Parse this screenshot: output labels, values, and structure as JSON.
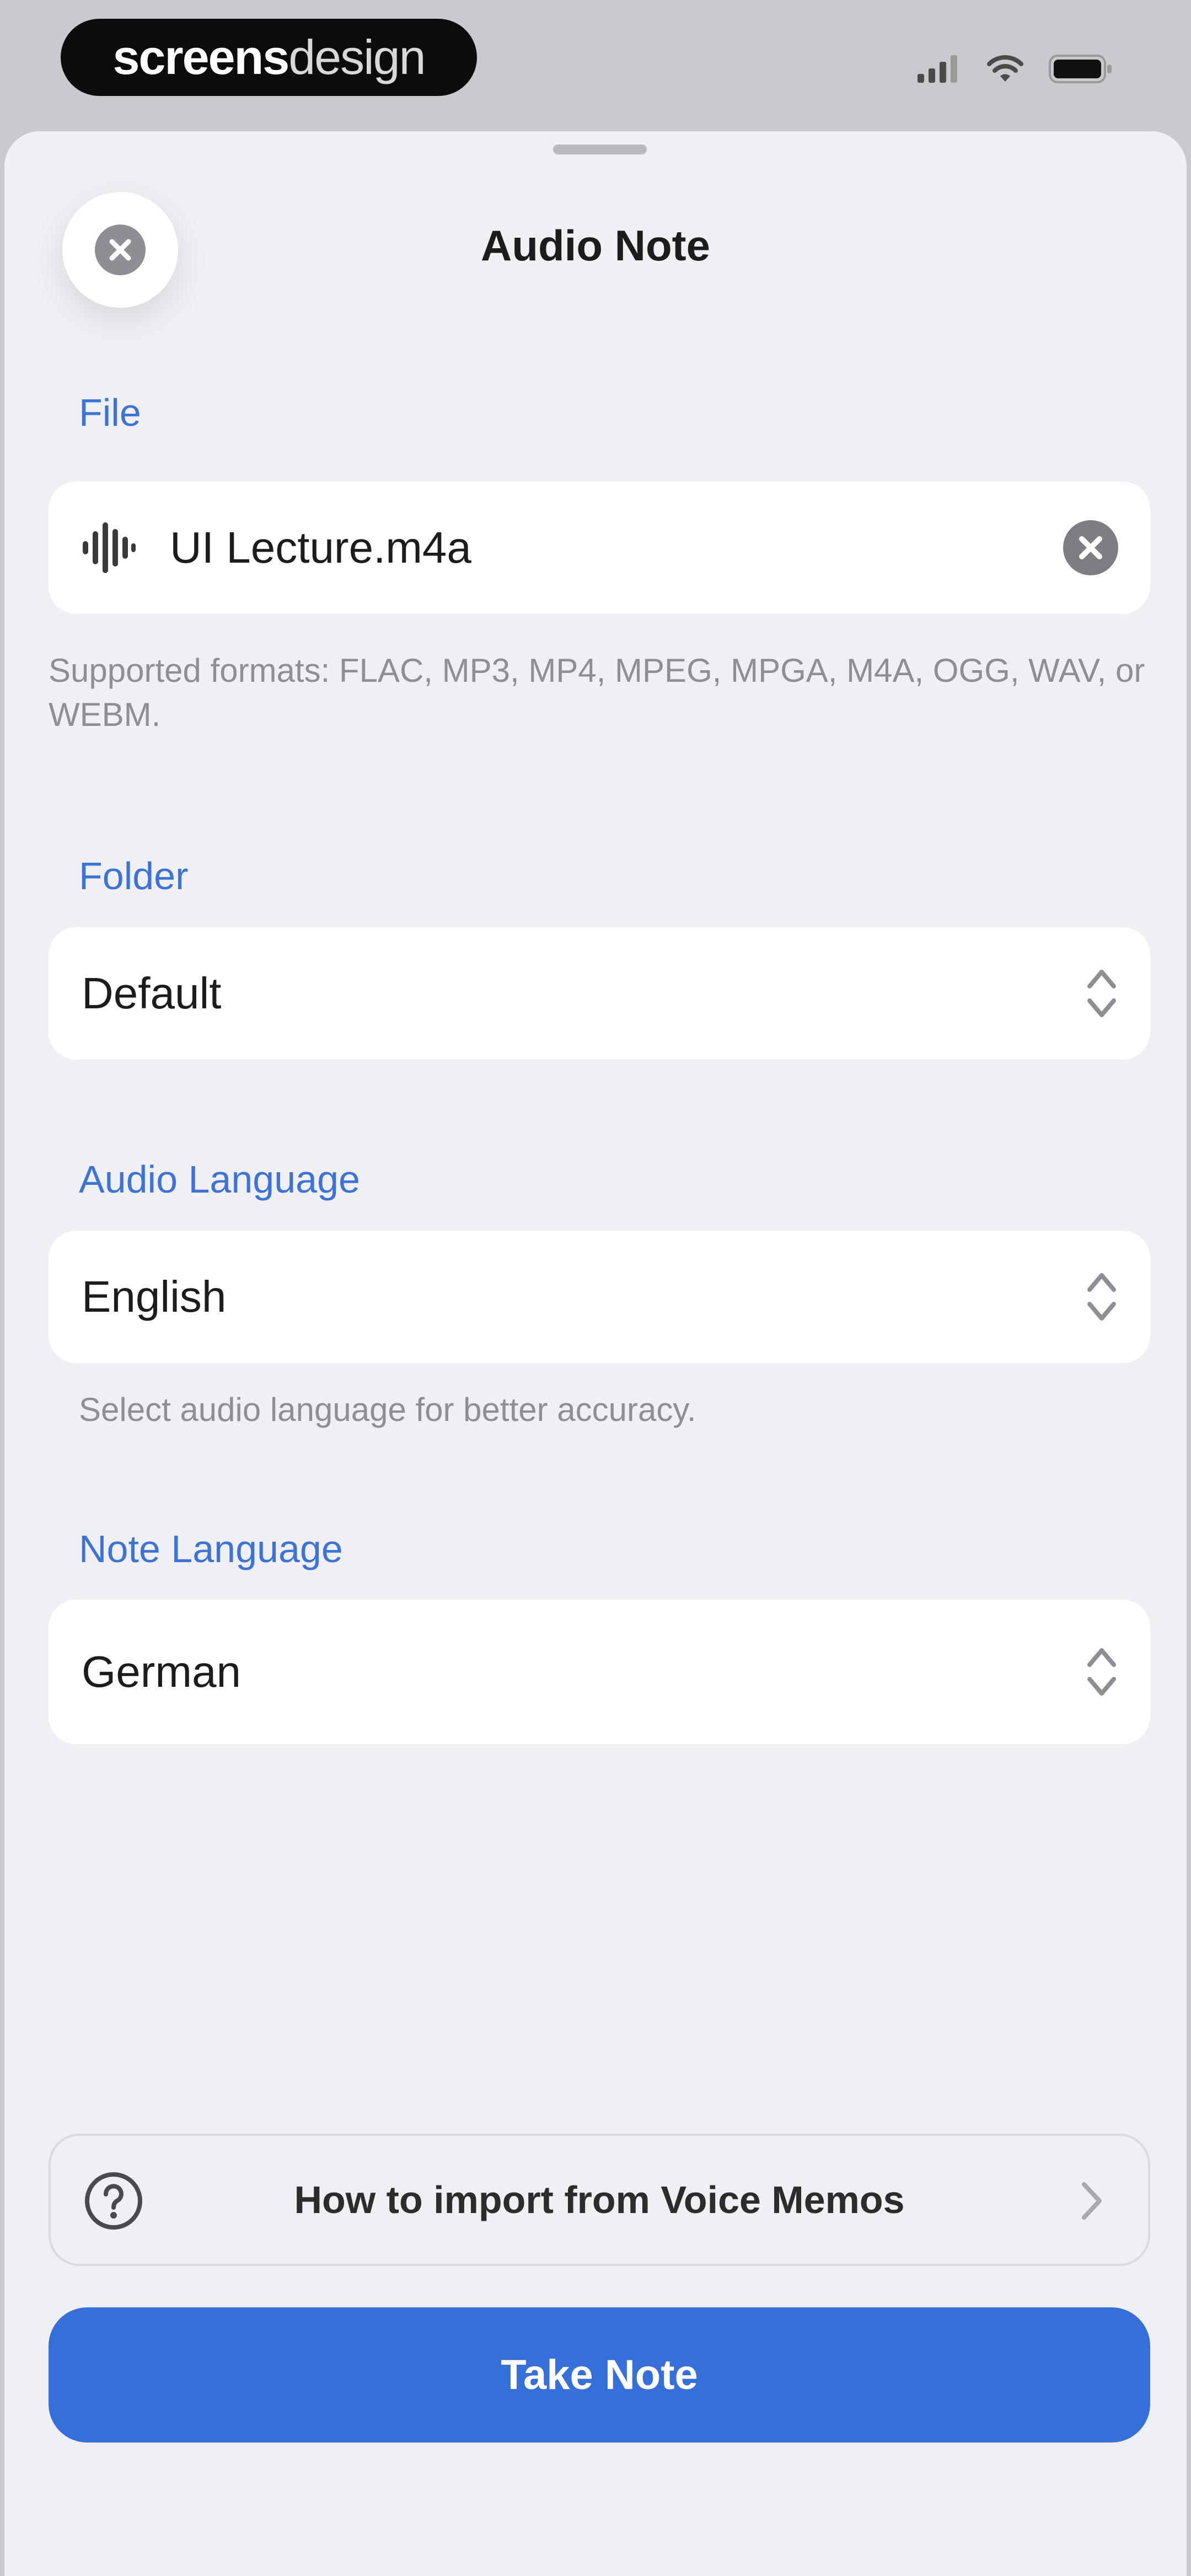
{
  "status_bar": {
    "brand_strong": "screens",
    "brand_light": "design"
  },
  "sheet": {
    "title": "Audio Note"
  },
  "file": {
    "label": "File",
    "filename": "UI Lecture.m4a",
    "helper": "Supported formats: FLAC, MP3, MP4, MPEG, MPGA, M4A, OGG, WAV, or WEBM."
  },
  "folder": {
    "label": "Folder",
    "value": "Default"
  },
  "audio_language": {
    "label": "Audio Language",
    "value": "English",
    "helper": "Select audio language for better accuracy."
  },
  "note_language": {
    "label": "Note Language",
    "value": "German"
  },
  "import_help": {
    "label": "How to import from Voice Memos"
  },
  "primary_action": {
    "label": "Take Note"
  },
  "colors": {
    "accent": "#356fd9",
    "section_label": "#3b73d9",
    "sheet_background": "#efeff4",
    "field_background": "#ffffff"
  },
  "icons": {
    "close": "close-circle-icon",
    "audio_file": "waveform-icon",
    "clear": "clear-circle-icon",
    "stepper": "chevron-up-down-icon",
    "help": "question-circle-icon",
    "disclosure": "chevron-right-icon"
  }
}
